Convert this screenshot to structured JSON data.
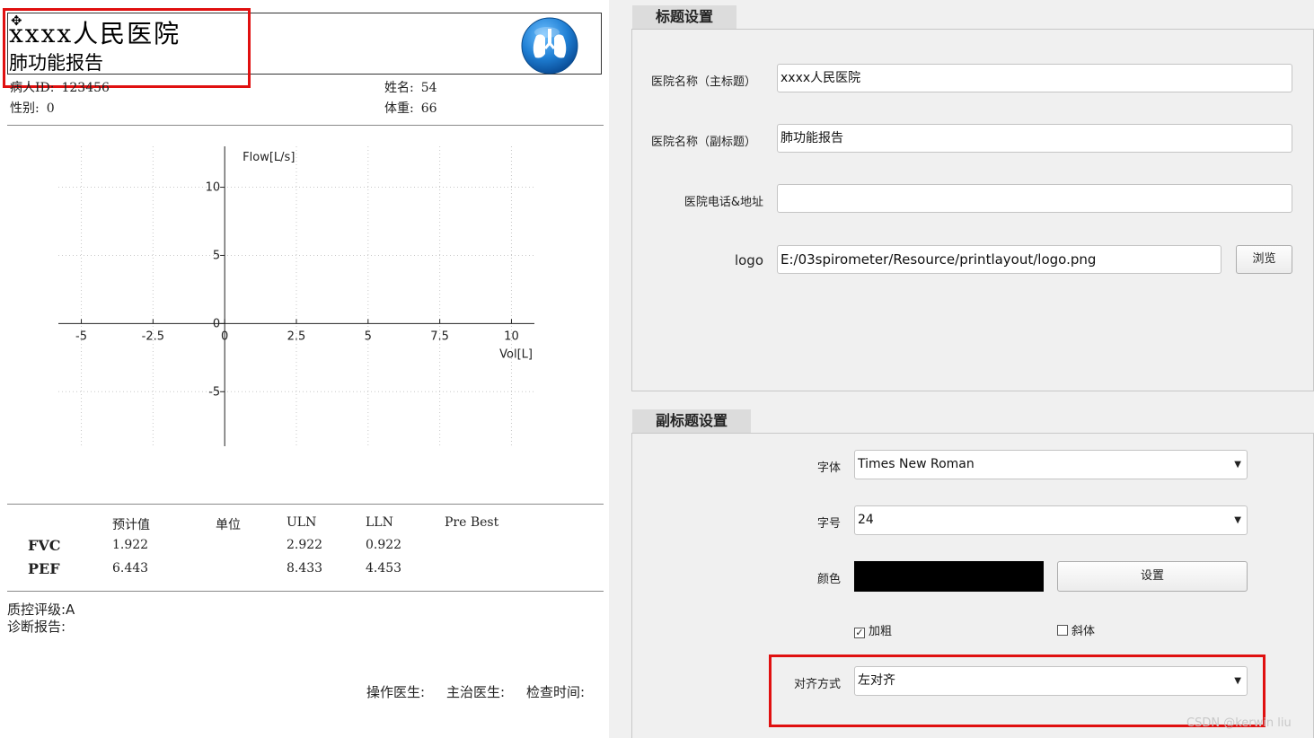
{
  "report": {
    "main_title": "xxxx人民医院",
    "sub_title": "肺功能报告",
    "patient": {
      "id_label": "病人ID:",
      "id_value": "123456",
      "gender_label": "性别:",
      "gender_value": "0",
      "name_label": "姓名:",
      "name_value": "54",
      "weight_label": "体重:",
      "weight_value": "66"
    },
    "table": {
      "headers": [
        "预计值",
        "单位",
        "ULN",
        "LLN",
        "Pre Best"
      ],
      "rows": [
        {
          "name": "FVC",
          "predicted": "1.922",
          "unit": "",
          "uln": "2.922",
          "lln": "0.922",
          "pre_best": ""
        },
        {
          "name": "PEF",
          "predicted": "6.443",
          "unit": "",
          "uln": "8.433",
          "lln": "4.453",
          "pre_best": ""
        }
      ]
    },
    "quality": "质控评级:A",
    "diagnosis": "诊断报告:",
    "footer": {
      "operator": "操作医生:",
      "attending": "主治医生:",
      "exam_time": "检查时间:"
    }
  },
  "chart_data": {
    "type": "line",
    "title": "",
    "xlabel": "Vol[L]",
    "ylabel": "Flow[L/s]",
    "xlim": [
      -5.8,
      10.8
    ],
    "ylim": [
      -9,
      13
    ],
    "x_ticks": [
      -5,
      -2.5,
      0,
      2.5,
      5,
      7.5,
      10
    ],
    "x_tick_labels": [
      "-5",
      "-2.5",
      "0",
      "2.5",
      "5",
      "7.5",
      "10"
    ],
    "y_ticks": [
      -5,
      0,
      5,
      10
    ],
    "y_tick_labels": [
      "-5",
      "0",
      "5",
      "10"
    ],
    "grid": true,
    "series": []
  },
  "title_settings": {
    "group_title": "标题设置",
    "main_label": "医院名称（主标题）",
    "main_value": "xxxx人民医院",
    "sub_label": "医院名称（副标题）",
    "sub_value": "肺功能报告",
    "phone_label": "医院电话&地址",
    "phone_value": "",
    "logo_label": "logo",
    "logo_value": "E:/03spirometer/Resource/printlayout/logo.png",
    "browse_label": "浏览"
  },
  "subtitle_settings": {
    "group_title": "副标题设置",
    "font_label": "字体",
    "font_value": "Times New Roman",
    "size_label": "字号",
    "size_value": "24",
    "color_label": "颜色",
    "color_value": "#000000",
    "set_label": "设置",
    "bold_label": "加粗",
    "bold_checked": true,
    "italic_label": "斜体",
    "italic_checked": false,
    "align_label": "对齐方式",
    "align_value": "左对齐"
  },
  "watermark": "CSDN @kerwin liu",
  "colors": {
    "highlight": "#e01010",
    "logo_blue": "#1f7fd4"
  },
  "icons": {
    "move": "move-cross-icon",
    "logo": "lungs-logo-icon",
    "dropdown": "chevron-down-icon"
  }
}
